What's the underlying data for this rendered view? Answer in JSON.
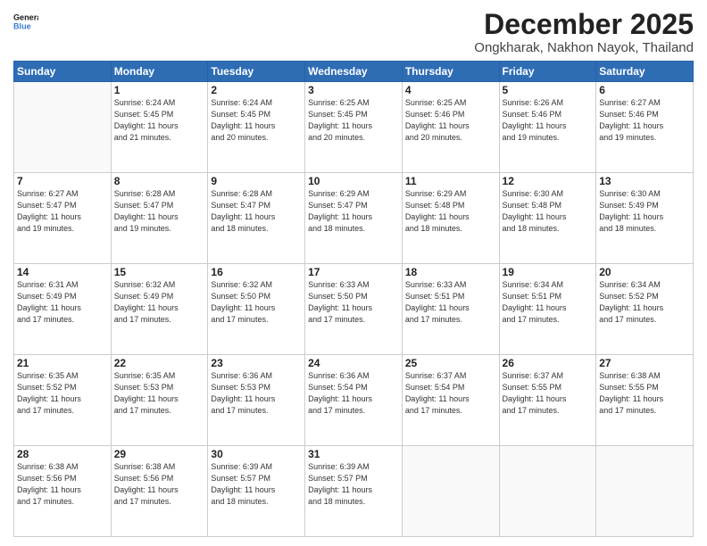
{
  "logo": {
    "line1": "General",
    "line2": "Blue"
  },
  "title": "December 2025",
  "subtitle": "Ongkharak, Nakhon Nayok, Thailand",
  "header_row": [
    "Sunday",
    "Monday",
    "Tuesday",
    "Wednesday",
    "Thursday",
    "Friday",
    "Saturday"
  ],
  "weeks": [
    [
      {
        "day": "",
        "info": ""
      },
      {
        "day": "1",
        "info": "Sunrise: 6:24 AM\nSunset: 5:45 PM\nDaylight: 11 hours\nand 21 minutes."
      },
      {
        "day": "2",
        "info": "Sunrise: 6:24 AM\nSunset: 5:45 PM\nDaylight: 11 hours\nand 20 minutes."
      },
      {
        "day": "3",
        "info": "Sunrise: 6:25 AM\nSunset: 5:45 PM\nDaylight: 11 hours\nand 20 minutes."
      },
      {
        "day": "4",
        "info": "Sunrise: 6:25 AM\nSunset: 5:46 PM\nDaylight: 11 hours\nand 20 minutes."
      },
      {
        "day": "5",
        "info": "Sunrise: 6:26 AM\nSunset: 5:46 PM\nDaylight: 11 hours\nand 19 minutes."
      },
      {
        "day": "6",
        "info": "Sunrise: 6:27 AM\nSunset: 5:46 PM\nDaylight: 11 hours\nand 19 minutes."
      }
    ],
    [
      {
        "day": "7",
        "info": "Sunrise: 6:27 AM\nSunset: 5:47 PM\nDaylight: 11 hours\nand 19 minutes."
      },
      {
        "day": "8",
        "info": "Sunrise: 6:28 AM\nSunset: 5:47 PM\nDaylight: 11 hours\nand 19 minutes."
      },
      {
        "day": "9",
        "info": "Sunrise: 6:28 AM\nSunset: 5:47 PM\nDaylight: 11 hours\nand 18 minutes."
      },
      {
        "day": "10",
        "info": "Sunrise: 6:29 AM\nSunset: 5:47 PM\nDaylight: 11 hours\nand 18 minutes."
      },
      {
        "day": "11",
        "info": "Sunrise: 6:29 AM\nSunset: 5:48 PM\nDaylight: 11 hours\nand 18 minutes."
      },
      {
        "day": "12",
        "info": "Sunrise: 6:30 AM\nSunset: 5:48 PM\nDaylight: 11 hours\nand 18 minutes."
      },
      {
        "day": "13",
        "info": "Sunrise: 6:30 AM\nSunset: 5:49 PM\nDaylight: 11 hours\nand 18 minutes."
      }
    ],
    [
      {
        "day": "14",
        "info": "Sunrise: 6:31 AM\nSunset: 5:49 PM\nDaylight: 11 hours\nand 17 minutes."
      },
      {
        "day": "15",
        "info": "Sunrise: 6:32 AM\nSunset: 5:49 PM\nDaylight: 11 hours\nand 17 minutes."
      },
      {
        "day": "16",
        "info": "Sunrise: 6:32 AM\nSunset: 5:50 PM\nDaylight: 11 hours\nand 17 minutes."
      },
      {
        "day": "17",
        "info": "Sunrise: 6:33 AM\nSunset: 5:50 PM\nDaylight: 11 hours\nand 17 minutes."
      },
      {
        "day": "18",
        "info": "Sunrise: 6:33 AM\nSunset: 5:51 PM\nDaylight: 11 hours\nand 17 minutes."
      },
      {
        "day": "19",
        "info": "Sunrise: 6:34 AM\nSunset: 5:51 PM\nDaylight: 11 hours\nand 17 minutes."
      },
      {
        "day": "20",
        "info": "Sunrise: 6:34 AM\nSunset: 5:52 PM\nDaylight: 11 hours\nand 17 minutes."
      }
    ],
    [
      {
        "day": "21",
        "info": "Sunrise: 6:35 AM\nSunset: 5:52 PM\nDaylight: 11 hours\nand 17 minutes."
      },
      {
        "day": "22",
        "info": "Sunrise: 6:35 AM\nSunset: 5:53 PM\nDaylight: 11 hours\nand 17 minutes."
      },
      {
        "day": "23",
        "info": "Sunrise: 6:36 AM\nSunset: 5:53 PM\nDaylight: 11 hours\nand 17 minutes."
      },
      {
        "day": "24",
        "info": "Sunrise: 6:36 AM\nSunset: 5:54 PM\nDaylight: 11 hours\nand 17 minutes."
      },
      {
        "day": "25",
        "info": "Sunrise: 6:37 AM\nSunset: 5:54 PM\nDaylight: 11 hours\nand 17 minutes."
      },
      {
        "day": "26",
        "info": "Sunrise: 6:37 AM\nSunset: 5:55 PM\nDaylight: 11 hours\nand 17 minutes."
      },
      {
        "day": "27",
        "info": "Sunrise: 6:38 AM\nSunset: 5:55 PM\nDaylight: 11 hours\nand 17 minutes."
      }
    ],
    [
      {
        "day": "28",
        "info": "Sunrise: 6:38 AM\nSunset: 5:56 PM\nDaylight: 11 hours\nand 17 minutes."
      },
      {
        "day": "29",
        "info": "Sunrise: 6:38 AM\nSunset: 5:56 PM\nDaylight: 11 hours\nand 17 minutes."
      },
      {
        "day": "30",
        "info": "Sunrise: 6:39 AM\nSunset: 5:57 PM\nDaylight: 11 hours\nand 18 minutes."
      },
      {
        "day": "31",
        "info": "Sunrise: 6:39 AM\nSunset: 5:57 PM\nDaylight: 11 hours\nand 18 minutes."
      },
      {
        "day": "",
        "info": ""
      },
      {
        "day": "",
        "info": ""
      },
      {
        "day": "",
        "info": ""
      }
    ]
  ]
}
